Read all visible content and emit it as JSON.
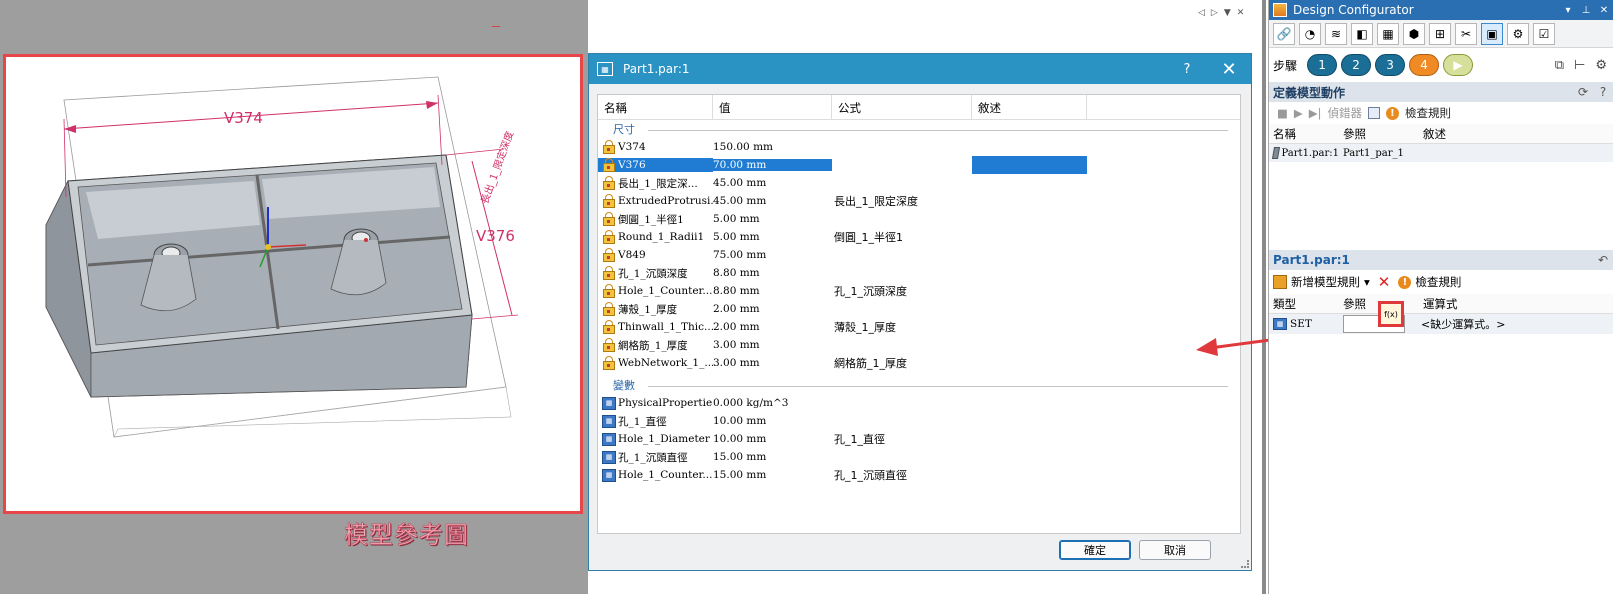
{
  "canvas": {
    "dims": {
      "width_label": "V374",
      "height_label": "V376",
      "side_label": "長出_1_限定深度"
    },
    "caption": "模型參考圖"
  },
  "dialog": {
    "title": "Part1.par:1",
    "help": "?",
    "close": "✕",
    "columns": {
      "name": "名稱",
      "value": "值",
      "formula": "公式",
      "description": "敘述"
    },
    "groups": [
      {
        "label": "尺寸",
        "kind": "dimension",
        "rows": [
          {
            "name": "V374",
            "value": "150.00 mm",
            "formula": "",
            "selected": false
          },
          {
            "name": "V376",
            "value": "70.00 mm",
            "formula": "",
            "selected": true
          },
          {
            "name": "長出_1_限定深...",
            "value": "45.00 mm",
            "formula": "",
            "selected": false
          },
          {
            "name": "ExtrudedProtrusi...",
            "value": "45.00 mm",
            "formula": "長出_1_限定深度",
            "selected": false
          },
          {
            "name": "倒圓_1_半徑1",
            "value": "5.00 mm",
            "formula": "",
            "selected": false
          },
          {
            "name": "Round_1_Radii1",
            "value": "5.00 mm",
            "formula": "倒圓_1_半徑1",
            "selected": false
          },
          {
            "name": "V849",
            "value": "75.00 mm",
            "formula": "",
            "selected": false
          },
          {
            "name": "孔_1_沉頭深度",
            "value": "8.80 mm",
            "formula": "",
            "selected": false
          },
          {
            "name": "Hole_1_Counter...",
            "value": "8.80 mm",
            "formula": "孔_1_沉頭深度",
            "selected": false
          },
          {
            "name": "薄殼_1_厚度",
            "value": "2.00 mm",
            "formula": "",
            "selected": false
          },
          {
            "name": "Thinwall_1_Thic...",
            "value": "2.00 mm",
            "formula": "薄殼_1_厚度",
            "selected": false
          },
          {
            "name": "網格筋_1_厚度",
            "value": "3.00 mm",
            "formula": "",
            "selected": false
          },
          {
            "name": "WebNetwork_1_...",
            "value": "3.00 mm",
            "formula": "網格筋_1_厚度",
            "selected": false
          }
        ]
      },
      {
        "label": "變數",
        "kind": "variable",
        "rows": [
          {
            "name": "PhysicalPropertie...",
            "value": "0.000 kg/m^3",
            "formula": "",
            "selected": false
          },
          {
            "name": "孔_1_直徑",
            "value": "10.00 mm",
            "formula": "",
            "selected": false
          },
          {
            "name": "Hole_1_Diameter",
            "value": "10.00 mm",
            "formula": "孔_1_直徑",
            "selected": false
          },
          {
            "name": "孔_1_沉頭直徑",
            "value": "15.00 mm",
            "formula": "",
            "selected": false
          },
          {
            "name": "Hole_1_Counter...",
            "value": "15.00 mm",
            "formula": "孔_1_沉頭直徑",
            "selected": false
          }
        ]
      }
    ],
    "ok_label": "確定",
    "cancel_label": "取消"
  },
  "panel": {
    "title": "Design Configurator",
    "title_controls": [
      "▾",
      "⊥",
      "✕"
    ],
    "steps_label": "步驟",
    "steps": [
      "1",
      "2",
      "3",
      "4"
    ],
    "step_play": "▶",
    "current_step": 4,
    "section1": {
      "title": "定義模型動作",
      "toolbar": {
        "stop": "■",
        "play": "▶",
        "step": "▶|",
        "debugger": "偵錯器",
        "check_rules": "檢查規則"
      },
      "columns": {
        "name": "名稱",
        "ref": "參照",
        "desc": "敘述"
      },
      "rows": [
        {
          "name": "Part1.par:1",
          "ref": "Part1_par_1",
          "desc": ""
        }
      ]
    },
    "section2": {
      "title": "Part1.par:1",
      "new_rule": "新增模型規則",
      "check_rules": "檢查規則",
      "columns": {
        "type": "類型",
        "ref": "參照",
        "formula": "運算式"
      },
      "rows": [
        {
          "type": "SET",
          "ref": "",
          "formula": "<缺少運算式。>"
        }
      ],
      "fx_label": "f(x)"
    }
  },
  "colors": {
    "accent": "#2b93c4",
    "selection": "#1f7cd2",
    "highlight_red": "#e0393b"
  }
}
